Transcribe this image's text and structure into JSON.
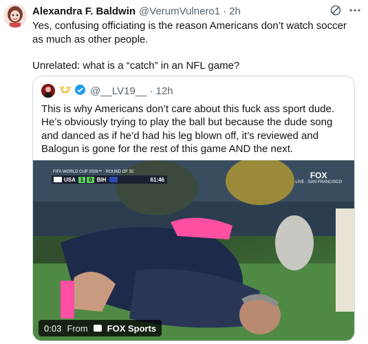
{
  "tweet": {
    "author_name": "Alexandra F. Baldwin",
    "author_handle": "@VerumVulnero1",
    "time": "2h",
    "lines": [
      "Yes, confusing officiating is the reason Americans don’t watch soccer as much as other people.",
      "Unrelated: what is a “catch” in an NFL game?"
    ]
  },
  "quote": {
    "handle": "@__LV19__",
    "time": "12h",
    "text": "This is why Americans don’t care about this fuck ass sport dude. He’s obviously trying to play the ball but because the dude song and danced as if he’d had his leg blown off, it’s reviewed and Balogun is gone for the rest of this game AND the next."
  },
  "media": {
    "score_caption": "FIFA WORLD CUP 2026™ · ROUND OF 32",
    "team_home": "USA",
    "score_home": "1",
    "score_away": "0",
    "team_away": "BIH",
    "clock": "61:46",
    "bug_brand": "FOX",
    "bug_location": "LIVE · SAN FRANCISCO",
    "elapsed": "0:03",
    "from_label": "From",
    "source": "FOX Sports"
  },
  "colors": {
    "accent_blue": "#1d9bf0",
    "text_gray": "#536471",
    "border": "#cfd9de"
  },
  "icons": [
    "grok-icon",
    "more-icon",
    "verified-badge-icon"
  ]
}
